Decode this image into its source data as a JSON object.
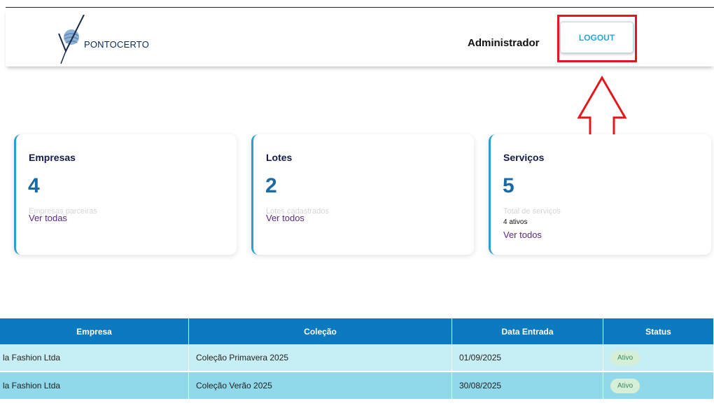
{
  "header": {
    "brand": "PONTOCERTO",
    "user_role": "Administrador",
    "logout_label": "LOGOUT"
  },
  "cards": [
    {
      "title": "Empresas",
      "value": "4",
      "description": "Empresas parceiras",
      "extra": "",
      "link": "Ver todas"
    },
    {
      "title": "Lotes",
      "value": "2",
      "description": "Lotes cadastrados",
      "extra": "",
      "link": "Ver todos"
    },
    {
      "title": "Serviços",
      "value": "5",
      "description": "Total de serviços",
      "extra": "4 ativos",
      "link": "Ver todos"
    }
  ],
  "table": {
    "headers": [
      "Empresa",
      "Coleção",
      "Data Entrada",
      "Status"
    ],
    "rows": [
      {
        "empresa": "la Fashion Ltda",
        "colecao": "Coleção Primavera 2025",
        "data": "01/09/2025",
        "status": "Ativo"
      },
      {
        "empresa": "la Fashion Ltda",
        "colecao": "Coleção Verão 2025",
        "data": "30/08/2025",
        "status": "Ativo"
      }
    ]
  },
  "colors": {
    "accent": "#27a9d6",
    "header_table": "#0b7abf",
    "highlight": "#e3171c",
    "link": "#5a2a86"
  }
}
